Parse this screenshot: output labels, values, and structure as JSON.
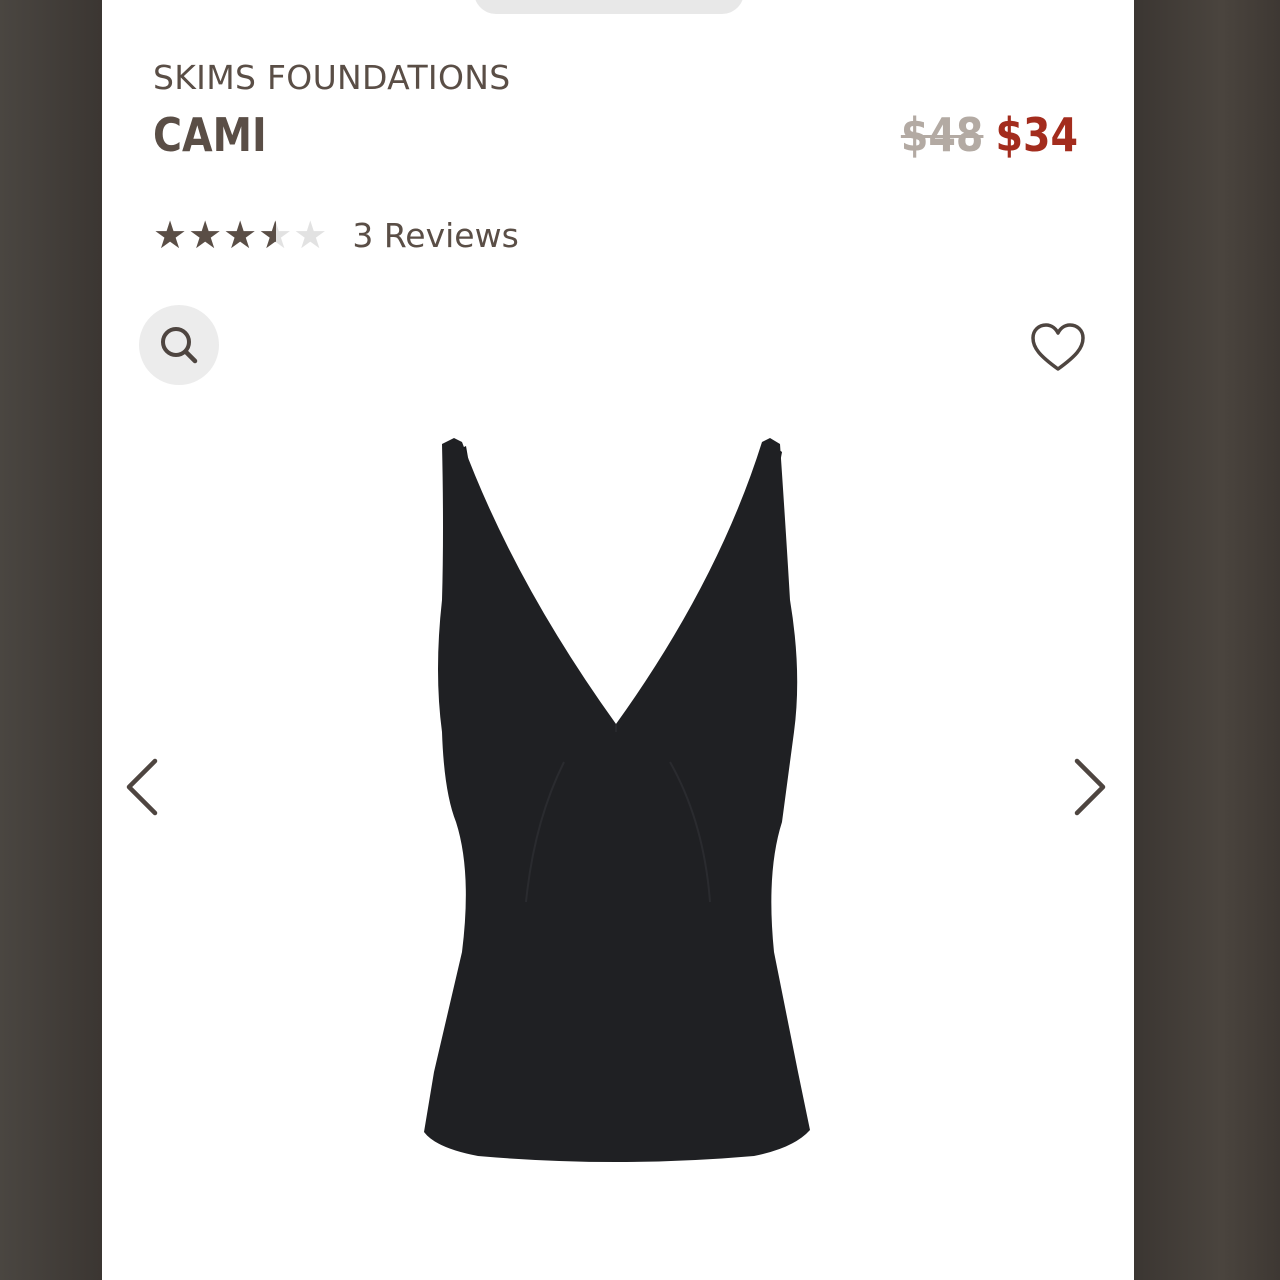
{
  "product": {
    "brand": "SKIMS FOUNDATIONS",
    "name": "CAMI",
    "price_original": "$48",
    "price_sale": "$34",
    "rating_value": 3.5,
    "rating_max": 5,
    "stars_glyphs": "★★★★★",
    "reviews_label": "3 Reviews"
  },
  "icons": {
    "zoom": "search-icon",
    "favorite": "heart-icon",
    "previous": "chevron-left-icon",
    "next": "chevron-right-icon"
  },
  "colors": {
    "text_primary": "#5a4e46",
    "price_sale": "#a32c1d",
    "price_original": "#b3aaa3",
    "product_garment": "#1f2023",
    "button_bg": "#ececec"
  }
}
